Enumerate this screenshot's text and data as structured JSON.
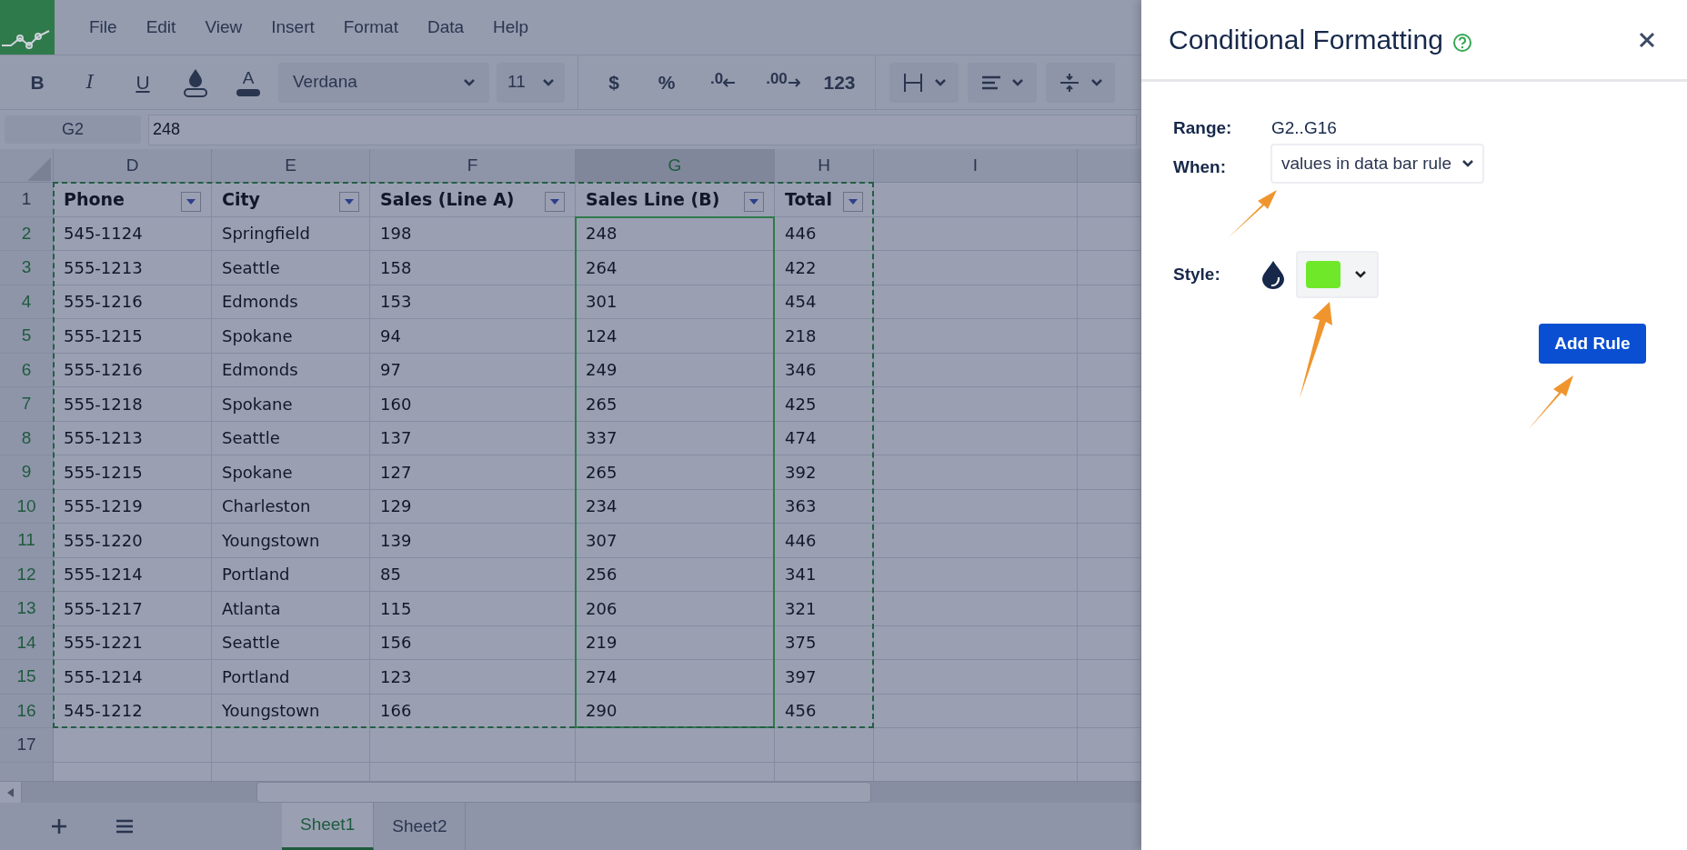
{
  "menu": [
    "File",
    "Edit",
    "View",
    "Insert",
    "Format",
    "Data",
    "Help"
  ],
  "toolbar": {
    "items": [
      {
        "kind": "bold",
        "label": "B"
      },
      {
        "kind": "italic",
        "label": "I"
      },
      {
        "kind": "underline",
        "label": "U"
      },
      {
        "kind": "fill"
      },
      {
        "kind": "text-color",
        "label": "A"
      },
      {
        "kind": "font-select",
        "label": "Verdana"
      },
      {
        "kind": "size-select",
        "label": "11"
      },
      {
        "kind": "separator"
      },
      {
        "kind": "bold",
        "label": "$"
      },
      {
        "kind": "bold",
        "label": "%"
      },
      {
        "kind": "decrease-decimal",
        "label": ".0"
      },
      {
        "kind": "increase-decimal",
        "label": ".00"
      },
      {
        "kind": "bold",
        "label": "123"
      },
      {
        "kind": "separator"
      },
      {
        "kind": "borders"
      },
      {
        "kind": "align"
      },
      {
        "kind": "valign"
      }
    ]
  },
  "formula_bar": {
    "cell": "G2",
    "value": "248"
  },
  "sheet": {
    "columns": [
      {
        "label": "D",
        "selected": false
      },
      {
        "label": "E",
        "selected": false
      },
      {
        "label": "F",
        "selected": false
      },
      {
        "label": "G",
        "selected": true
      },
      {
        "label": "H",
        "selected": false
      },
      {
        "label": "I",
        "selected": false
      }
    ],
    "rows": [
      {
        "number": "1",
        "selected": false,
        "kind": "header",
        "cells": [
          "Phone",
          "City",
          "Sales (Line A)",
          "Sales Line (B)",
          "Total"
        ]
      },
      {
        "number": "2",
        "selected": true,
        "kind": "data",
        "cells": [
          "545-1124",
          "Springfield",
          "198",
          "248",
          "446"
        ]
      },
      {
        "number": "3",
        "selected": true,
        "kind": "data",
        "cells": [
          "555-1213",
          "Seattle",
          "158",
          "264",
          "422"
        ]
      },
      {
        "number": "4",
        "selected": true,
        "kind": "data",
        "cells": [
          "555-1216",
          "Edmonds",
          "153",
          "301",
          "454"
        ]
      },
      {
        "number": "5",
        "selected": true,
        "kind": "data",
        "cells": [
          "555-1215",
          "Spokane",
          "94",
          "124",
          "218"
        ]
      },
      {
        "number": "6",
        "selected": true,
        "kind": "data",
        "cells": [
          "555-1216",
          "Edmonds",
          "97",
          "249",
          "346"
        ]
      },
      {
        "number": "7",
        "selected": true,
        "kind": "data",
        "cells": [
          "555-1218",
          "Spokane",
          "160",
          "265",
          "425"
        ]
      },
      {
        "number": "8",
        "selected": true,
        "kind": "data",
        "cells": [
          "555-1213",
          "Seattle",
          "137",
          "337",
          "474"
        ]
      },
      {
        "number": "9",
        "selected": true,
        "kind": "data",
        "cells": [
          "555-1215",
          "Spokane",
          "127",
          "265",
          "392"
        ]
      },
      {
        "number": "10",
        "selected": true,
        "kind": "data",
        "cells": [
          "555-1219",
          "Charleston",
          "129",
          "234",
          "363"
        ]
      },
      {
        "number": "11",
        "selected": true,
        "kind": "data",
        "cells": [
          "555-1220",
          "Youngstown",
          "139",
          "307",
          "446"
        ]
      },
      {
        "number": "12",
        "selected": true,
        "kind": "data",
        "cells": [
          "555-1214",
          "Portland",
          "85",
          "256",
          "341"
        ]
      },
      {
        "number": "13",
        "selected": true,
        "kind": "data",
        "cells": [
          "555-1217",
          "Atlanta",
          "115",
          "206",
          "321"
        ]
      },
      {
        "number": "14",
        "selected": true,
        "kind": "data",
        "cells": [
          "555-1221",
          "Seattle",
          "156",
          "219",
          "375"
        ]
      },
      {
        "number": "15",
        "selected": true,
        "kind": "data",
        "cells": [
          "555-1214",
          "Portland",
          "123",
          "274",
          "397"
        ]
      },
      {
        "number": "16",
        "selected": true,
        "kind": "data",
        "cells": [
          "545-1212",
          "Youngstown",
          "166",
          "290",
          "456"
        ]
      },
      {
        "number": "17",
        "selected": false,
        "cells": []
      }
    ]
  },
  "sheet_tabs": [
    {
      "label": "Sheet1",
      "selected": true
    },
    {
      "label": "Sheet2",
      "selected": false
    }
  ],
  "panel": {
    "title": "Conditional Formatting",
    "range_label": "Range:",
    "range": "G2..G16",
    "when_label": "When:",
    "when": "values in data bar rule",
    "style_label": "Style:",
    "color": "#6fe82a",
    "button": "Add Rule"
  }
}
